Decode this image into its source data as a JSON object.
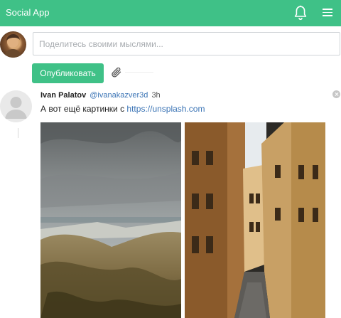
{
  "app": {
    "title": "Social App"
  },
  "header_icons": [
    "bell-icon",
    "menu-icon"
  ],
  "composer": {
    "placeholder": "Поделитесь своими мыслями...",
    "value": "",
    "publish_label": "Опубликовать",
    "attach_icon": "paperclip-icon"
  },
  "post": {
    "author": "Ivan Palatov",
    "handle": "@ivanakazver3d",
    "time": "3h",
    "text": "А вот ещё картинки с ",
    "link": "https://unsplash.com",
    "images": [
      "cloudy-hills-photo",
      "narrow-street-photo"
    ]
  },
  "colors": {
    "accent": "#3fc187",
    "link": "#3b74b5"
  }
}
